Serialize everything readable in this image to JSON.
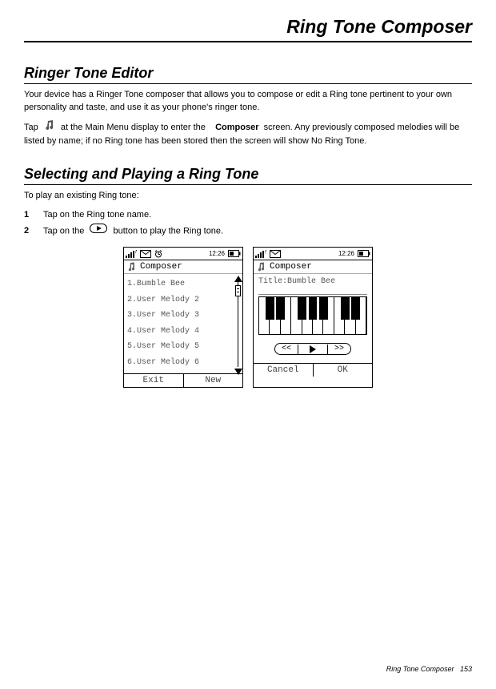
{
  "chapter_title": "Ring Tone Composer",
  "section1": {
    "title": "Ringer Tone Editor",
    "p1": "Your device has a Ringer Tone composer that allows you to compose or edit a Ring tone pertinent to your own personality and taste, and use it as your phone's ringer tone.",
    "p2a": "Tap",
    "p2b": "at the Main Menu display to enter the",
    "p2c": "Composer",
    "p2d": "screen. Any previously composed melodies will be listed by name; if no Ring tone has been stored then the screen will show No Ring Tone."
  },
  "section2": {
    "title": "Selecting and Playing a Ring Tone",
    "intro": "To play an existing Ring tone:",
    "steps": [
      {
        "num": "1",
        "text": "Tap on the Ring tone name."
      },
      {
        "num": "2",
        "before": "Tap on the",
        "after": "button to play the Ring tone."
      }
    ]
  },
  "phone_left": {
    "time": "12:26",
    "app_title": "Composer",
    "items": [
      "1.Bumble Bee",
      "2.User Melody 2",
      "3.User Melody 3",
      "4.User Melody 4",
      "5.User Melody 5",
      "6.User Melody 6"
    ],
    "soft_left": "Exit",
    "soft_right": "New"
  },
  "phone_right": {
    "time": "12:26",
    "app_title": "Composer",
    "title_label": "Title:Bumble Bee",
    "prev": "<<",
    "next": ">>",
    "soft_left": "Cancel",
    "soft_right": "OK"
  },
  "footer": {
    "label": "Ring Tone Composer",
    "page": "153"
  }
}
